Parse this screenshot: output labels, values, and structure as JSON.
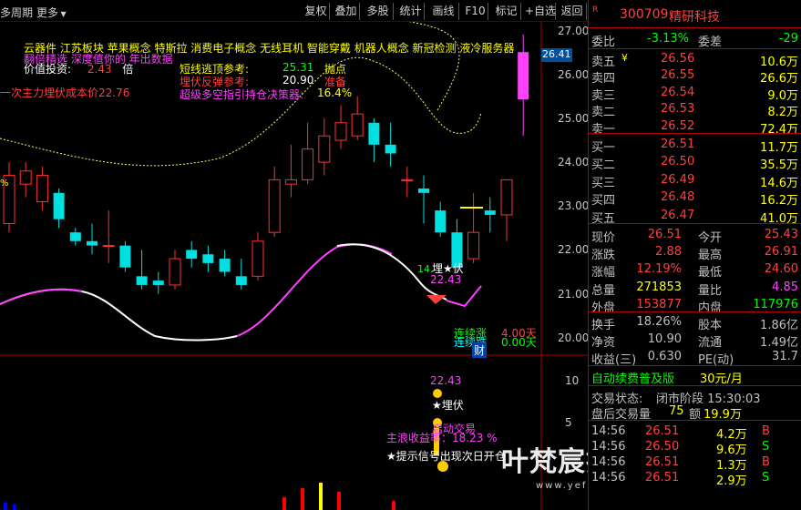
{
  "toolbar": {
    "left_label": "多周期",
    "more_label": "更多",
    "buttons": [
      "复权",
      "叠加",
      "多股",
      "统计",
      "画线",
      "F10",
      "标记",
      "+自选",
      "返回"
    ]
  },
  "overlays": {
    "concept_line": "云器件  江苏板块  苹果概念 特斯拉 消费电子概念 无线耳机 智能穿戴 机器人概念 新冠检测 液冷服务器",
    "magenta_line": "翻倍精选 深度值你的 年出数据",
    "value_label": "价值投资:",
    "value_num": "2.43",
    "value_unit": "倍",
    "cost_label": "一次主力埋伏成本价22.76",
    "short_top_label": "短线逃顶参考:",
    "short_top_value": "25.31",
    "short_top_tag": "抛点",
    "ambush_label": "埋伏反弹参考:",
    "ambush_value": "20.90",
    "ambush_tag": "准备",
    "super_label": "超级多空指引持仓决策器:",
    "super_value": "16.4%",
    "price_flag": "26.41",
    "low_mark": "14.",
    "ambush_star": "埋★伏",
    "low_price": "22.43",
    "rise_label": "连续涨",
    "rise_num": "4.00",
    "rise_unit": "天",
    "fall_label": "连续跌",
    "fall_num": "0.00",
    "fall_unit": "天",
    "cai_tag": "财",
    "sub_price": "22.43",
    "sub_ambush": "★埋伏",
    "sub_launch": "启动交易",
    "sub_profit": "主浪收益率：18.23 %",
    "sub_tip": "★提示信号出现次日开仓",
    "watermark": "叶梵宸指标公式网",
    "watermark_url": "www.yefanchen.com",
    "left_edge_mark": "%"
  },
  "y_axis_main": [
    "27.00",
    "26.00",
    "25.00",
    "24.00",
    "23.00",
    "22.00",
    "21.00",
    "20.00"
  ],
  "y_axis_sub": [
    "10",
    "5"
  ],
  "stock": {
    "badge": "R",
    "code": "300709",
    "name": "精研科技"
  },
  "order_book_header": {
    "webi_label": "委比",
    "webi_value": "-3.13%",
    "weicha_label": "委差",
    "weicha_value": "-29"
  },
  "sells": [
    {
      "label": "卖五",
      "mark": "¥",
      "price": "26.56",
      "vol": "10.6万"
    },
    {
      "label": "卖四",
      "mark": "",
      "price": "26.55",
      "vol": "26.6万"
    },
    {
      "label": "卖三",
      "mark": "",
      "price": "26.54",
      "vol": "9.0万"
    },
    {
      "label": "卖二",
      "mark": "",
      "price": "26.53",
      "vol": "8.2万"
    },
    {
      "label": "卖一",
      "mark": "",
      "price": "26.52",
      "vol": "72.4万"
    }
  ],
  "buys": [
    {
      "label": "买一",
      "price": "26.51",
      "vol": "11.7万"
    },
    {
      "label": "买二",
      "price": "26.50",
      "vol": "35.5万"
    },
    {
      "label": "买三",
      "price": "26.49",
      "vol": "14.6万"
    },
    {
      "label": "买四",
      "price": "26.48",
      "vol": "16.2万"
    },
    {
      "label": "买五",
      "price": "26.47",
      "vol": "41.0万"
    }
  ],
  "quote": [
    {
      "l1": "现价",
      "v1": "26.51",
      "c1": "#ff4040",
      "l2": "今开",
      "v2": "25.43",
      "c2": "#ff4040"
    },
    {
      "l1": "涨跌",
      "v1": "2.88",
      "c1": "#ff4040",
      "l2": "最高",
      "v2": "26.91",
      "c2": "#ff4040"
    },
    {
      "l1": "涨幅",
      "v1": "12.19%",
      "c1": "#ff4040",
      "l2": "最低",
      "v2": "24.60",
      "c2": "#ff4040"
    },
    {
      "l1": "总量",
      "v1": "271853",
      "c1": "#ffff00",
      "l2": "量比",
      "v2": "4.85",
      "c2": "#ff40ff"
    },
    {
      "l1": "外盘",
      "v1": "153877",
      "c1": "#ff4040",
      "l2": "内盘",
      "v2": "117976",
      "c2": "#00ff00"
    }
  ],
  "fundamentals": [
    {
      "l1": "换手",
      "v1": "18.26%",
      "l2": "股本",
      "v2": "1.86亿"
    },
    {
      "l1": "净资",
      "v1": "10.90",
      "l2": "流通",
      "v2": "1.49亿"
    },
    {
      "l1": "收益(三)",
      "v1": "0.630",
      "l2": "PE(动)",
      "v2": "31.7"
    }
  ],
  "promo": {
    "text": "自动续费普及版",
    "price": "30元/月"
  },
  "trade_status": {
    "label": "交易状态:",
    "value": "闭市阶段 15:30:03"
  },
  "after_hours": {
    "label": "盘后交易量",
    "vol": "75",
    "amt_label": "额",
    "amt": "19.9万"
  },
  "ticks": [
    {
      "time": "14:56",
      "price": "26.51",
      "vol": "4.2万",
      "side": "B"
    },
    {
      "time": "14:56",
      "price": "26.50",
      "vol": "9.6万",
      "side": "S"
    },
    {
      "time": "14:56",
      "price": "26.51",
      "vol": "1.3万",
      "side": "B"
    },
    {
      "time": "14:56",
      "price": "26.51",
      "vol": "2.9万",
      "side": "S"
    }
  ],
  "chart_data": {
    "type": "candlestick",
    "ylim": [
      19.6,
      27.2
    ],
    "candles": [
      {
        "o": 22.6,
        "c": 23.7,
        "h": 24.0,
        "l": 22.4
      },
      {
        "o": 23.5,
        "c": 23.8,
        "h": 24.0,
        "l": 23.2
      },
      {
        "o": 23.1,
        "c": 23.7,
        "h": 23.9,
        "l": 22.9
      },
      {
        "o": 23.3,
        "c": 22.7,
        "h": 23.4,
        "l": 22.5
      },
      {
        "o": 22.4,
        "c": 22.2,
        "h": 22.5,
        "l": 22.1
      },
      {
        "o": 22.2,
        "c": 22.1,
        "h": 22.6,
        "l": 21.9
      },
      {
        "o": 22.1,
        "c": 22.1,
        "h": 22.9,
        "l": 21.7
      },
      {
        "o": 22.1,
        "c": 21.6,
        "h": 22.2,
        "l": 21.5
      },
      {
        "o": 21.4,
        "c": 21.2,
        "h": 22.0,
        "l": 21.1
      },
      {
        "o": 21.3,
        "c": 21.2,
        "h": 21.5,
        "l": 21.0
      },
      {
        "o": 21.2,
        "c": 21.8,
        "h": 22.0,
        "l": 21.1
      },
      {
        "o": 22.0,
        "c": 21.8,
        "h": 22.2,
        "l": 21.6
      },
      {
        "o": 21.9,
        "c": 21.7,
        "h": 22.1,
        "l": 21.5
      },
      {
        "o": 21.8,
        "c": 21.5,
        "h": 22.0,
        "l": 21.4
      },
      {
        "o": 21.4,
        "c": 21.2,
        "h": 21.8,
        "l": 21.1
      },
      {
        "o": 21.4,
        "c": 22.2,
        "h": 22.4,
        "l": 21.3
      },
      {
        "o": 22.4,
        "c": 23.6,
        "h": 23.9,
        "l": 22.3
      },
      {
        "o": 23.5,
        "c": 23.6,
        "h": 24.4,
        "l": 23.2
      },
      {
        "o": 23.6,
        "c": 24.3,
        "h": 24.9,
        "l": 23.5
      },
      {
        "o": 24.0,
        "c": 24.6,
        "h": 25.0,
        "l": 23.7
      },
      {
        "o": 24.5,
        "c": 24.9,
        "h": 25.3,
        "l": 24.3
      },
      {
        "o": 24.6,
        "c": 25.1,
        "h": 25.5,
        "l": 24.5
      },
      {
        "o": 24.9,
        "c": 24.4,
        "h": 25.0,
        "l": 24.0
      },
      {
        "o": 24.4,
        "c": 24.2,
        "h": 24.9,
        "l": 23.9
      },
      {
        "o": 23.6,
        "c": 23.6,
        "h": 23.9,
        "l": 23.2
      },
      {
        "o": 23.4,
        "c": 23.3,
        "h": 23.7,
        "l": 22.6
      },
      {
        "o": 22.9,
        "c": 22.4,
        "h": 23.1,
        "l": 22.3
      },
      {
        "o": 22.4,
        "c": 21.6,
        "h": 22.7,
        "l": 21.5
      },
      {
        "o": 21.8,
        "c": 22.4,
        "h": 23.3,
        "l": 21.7
      },
      {
        "o": 22.9,
        "c": 22.8,
        "h": 23.2,
        "l": 22.4
      },
      {
        "o": 22.8,
        "c": 23.6,
        "h": 23.6,
        "l": 22.2
      },
      {
        "o": 25.43,
        "c": 26.51,
        "h": 26.91,
        "l": 24.6
      }
    ]
  }
}
